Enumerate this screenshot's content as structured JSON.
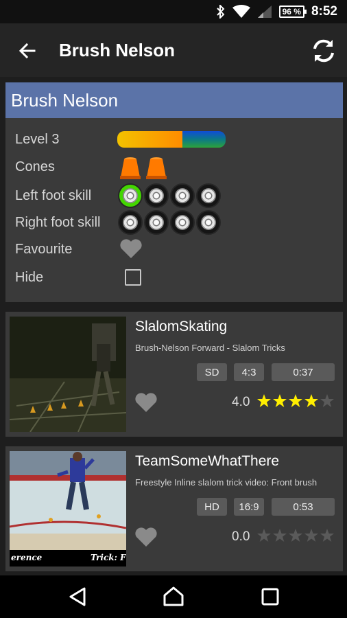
{
  "status_bar": {
    "time": "8:52",
    "battery": "96 %",
    "icons": [
      "bluetooth-icon",
      "wifi-icon",
      "signal-icon",
      "battery-icon"
    ]
  },
  "app_bar": {
    "title": "Brush Nelson",
    "back_icon": "arrow-left-icon",
    "refresh_icon": "refresh-icon"
  },
  "trick": {
    "name": "Brush Nelson",
    "rows": {
      "level": "Level 3",
      "cones": "Cones",
      "left_foot": "Left foot skill",
      "right_foot": "Right foot skill",
      "favourite": "Favourite",
      "hide": "Hide"
    },
    "level_progress": 0.6,
    "cones_count": 2,
    "left_foot_skill": 1,
    "right_foot_skill": 0,
    "skill_max": 4,
    "favourite": false,
    "hidden": false
  },
  "videos": [
    {
      "title": "SlalomSkating",
      "description": "Brush-Nelson Forward - Slalom Tricks",
      "quality": "SD",
      "ratio": "4:3",
      "duration": "0:37",
      "rating": "4.0",
      "stars": 4
    },
    {
      "title": "TeamSomeWhatThere",
      "description": "Freestyle Inline slalom trick video: Front brush",
      "quality": "HD",
      "ratio": "16:9",
      "duration": "0:53",
      "rating": "0.0",
      "stars": 0,
      "overlay_left": "erence",
      "overlay_right": "Trick: Fr"
    }
  ],
  "colors": {
    "header_blue": "#5b73a8",
    "star_yellow": "#ffee00",
    "skill_green": "#43d600"
  }
}
